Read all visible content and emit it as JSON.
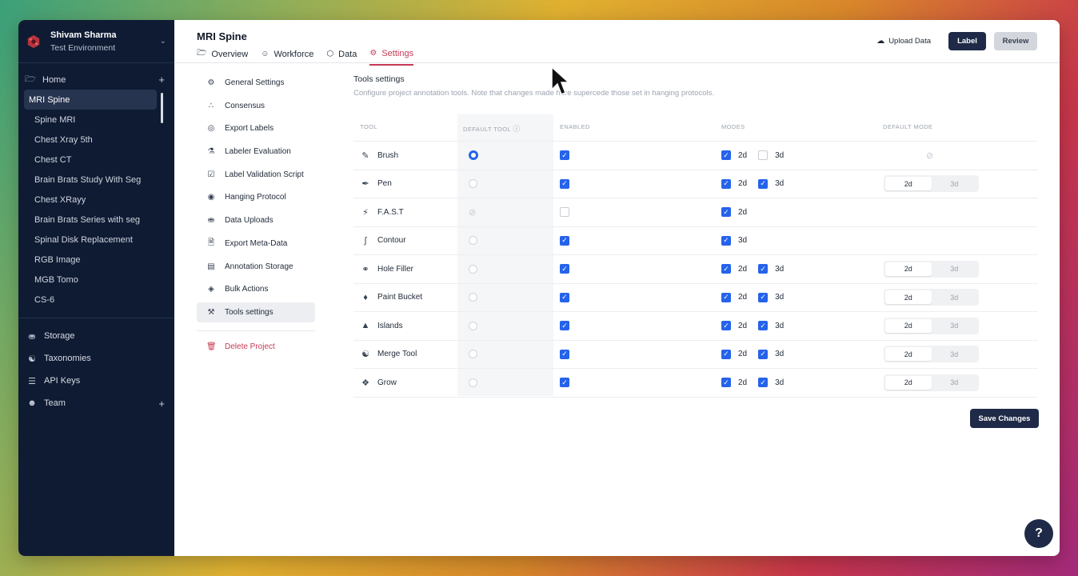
{
  "org": {
    "name": "Shivam Sharma",
    "environment": "Test Environment"
  },
  "sidebar": {
    "home_label": "Home",
    "projects": [
      "MRI Spine",
      "Spine MRI",
      "Chest Xray 5th",
      "Chest CT",
      "Brain Brats Study With Seg",
      "Chest XRayy",
      "Brain Brats Series with seg",
      "Spinal Disk Replacement",
      "RGB Image",
      "MGB Tomo",
      "CS-6"
    ],
    "bottom": [
      {
        "label": "Storage",
        "icon": "database-icon"
      },
      {
        "label": "Taxonomies",
        "icon": "hierarchy-icon"
      },
      {
        "label": "API Keys",
        "icon": "sliders-icon"
      },
      {
        "label": "Team",
        "icon": "team-icon"
      }
    ]
  },
  "header": {
    "project_title": "MRI Spine",
    "tabs": [
      "Overview",
      "Workforce",
      "Data",
      "Settings"
    ],
    "upload_label": "Upload Data",
    "label_btn": "Label",
    "review_btn": "Review"
  },
  "settings_menu": {
    "items": [
      "General Settings",
      "Consensus",
      "Export Labels",
      "Labeler Evaluation",
      "Label Validation Script",
      "Hanging Protocol",
      "Data Uploads",
      "Export Meta-Data",
      "Annotation Storage",
      "Bulk Actions",
      "Tools settings"
    ],
    "delete_label": "Delete Project"
  },
  "tools_settings": {
    "title": "Tools settings",
    "description": "Configure project annotation tools. Note that changes made here supercede those set in hanging protocols.",
    "columns": [
      "TOOL",
      "DEFAULT TOOL",
      "ENABLED",
      "MODES",
      "DEFAULT MODE"
    ],
    "mode_2d": "2d",
    "mode_3d": "3d",
    "tools": [
      {
        "name": "Brush",
        "icon": "brush-icon"
      },
      {
        "name": "Pen",
        "icon": "pen-icon"
      },
      {
        "name": "F.A.S.T",
        "icon": "lightning-icon"
      },
      {
        "name": "Contour",
        "icon": "contour-icon"
      },
      {
        "name": "Hole Filler",
        "icon": "hole-filler-icon"
      },
      {
        "name": "Paint Bucket",
        "icon": "paint-bucket-icon"
      },
      {
        "name": "Islands",
        "icon": "islands-icon"
      },
      {
        "name": "Merge Tool",
        "icon": "merge-icon"
      },
      {
        "name": "Grow",
        "icon": "grow-icon"
      }
    ],
    "save_label": "Save Changes"
  },
  "help_label": "?",
  "colors": {
    "sidebar_bg": "#0f1b33",
    "accent": "#c53b55",
    "primary_btn": "#1e2a47",
    "checkbox": "#2563eb"
  }
}
